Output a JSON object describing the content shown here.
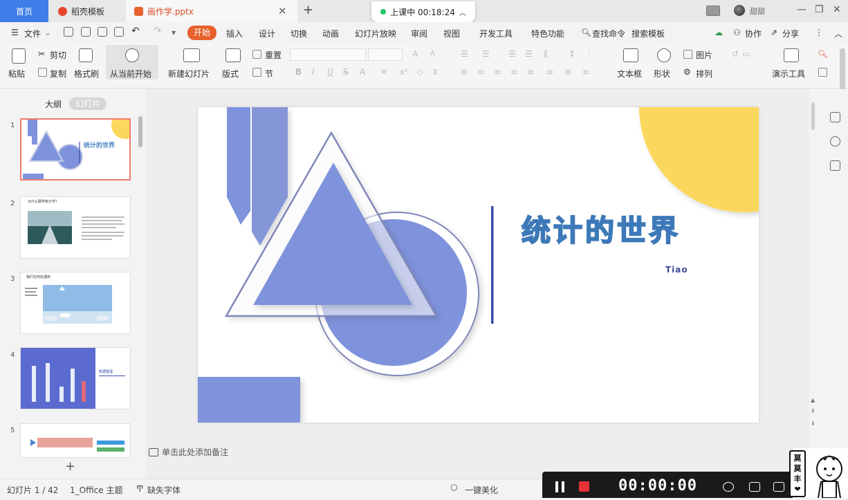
{
  "titlebar": {
    "home_tab": "首页",
    "doc_tab": "稻壳模板",
    "file_tab": "画作学.pptx",
    "class_timer": "上课中 00:18:24",
    "user": "甜甜"
  },
  "menubar": {
    "file": "文件",
    "active": "开始",
    "tabs": [
      "插入",
      "设计",
      "切换",
      "动画",
      "幻灯片放映",
      "审阅",
      "视图",
      "开发工具",
      "特色功能"
    ],
    "search": "查找命令",
    "search_template": "搜索模板",
    "collab": "协作",
    "share": "分享"
  },
  "ribbon": {
    "paste": "粘贴",
    "cut": "剪切",
    "copy": "复制",
    "format_painter": "格式刷",
    "from_current": "从当前开始",
    "new_slide": "新建幻灯片",
    "layout": "版式",
    "reset": "重置",
    "section": "节",
    "textbox": "文本框",
    "shape": "形状",
    "picture": "图片",
    "arrange": "排列",
    "present_tools": "演示工具"
  },
  "left_panel": {
    "outline_tab": "大纲",
    "slides_tab": "幻灯片",
    "thumbnails": [
      {
        "num": "1",
        "title": "统计的世界"
      },
      {
        "num": "2",
        "title": "为什么要学统计学？"
      },
      {
        "num": "3",
        "title": "我们在何处遇到"
      },
      {
        "num": "4",
        "title": "数据整理"
      },
      {
        "num": "5",
        "title": ""
      }
    ]
  },
  "slide": {
    "title": "统计的世界",
    "author": "Tiao",
    "colors": {
      "blue": "#7f93dc",
      "yellow": "#fbd85d",
      "accent_line": "#3a4aa8"
    }
  },
  "notes_hint": "单击此处添加备注",
  "statusbar": {
    "slide_pos": "幻灯片 1 / 42",
    "theme": "1_Office 主题",
    "missing_font": "缺失字体",
    "beautify": "一键美化"
  },
  "recorder": {
    "time": "00:00:00"
  },
  "mascot": {
    "text": "莫莫丰❤"
  }
}
